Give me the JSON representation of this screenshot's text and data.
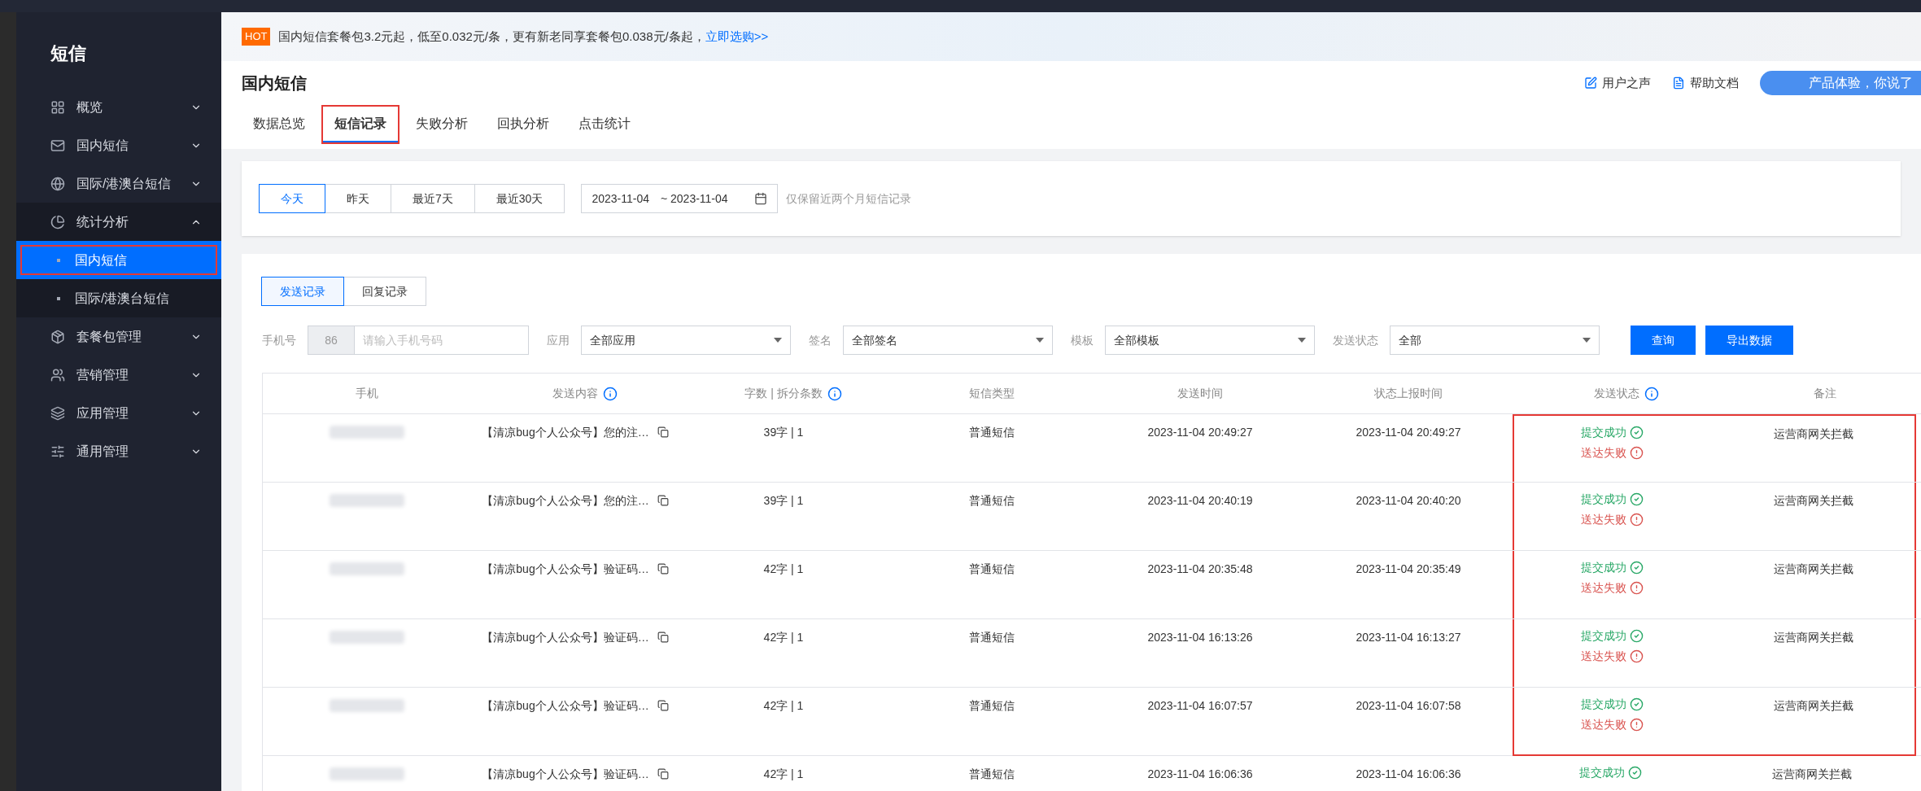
{
  "sidebar": {
    "title": "短信",
    "items": [
      {
        "label": "概览",
        "expanded": false,
        "selected": false
      },
      {
        "label": "国内短信",
        "expanded": false,
        "selected": false
      },
      {
        "label": "国际/港澳台短信",
        "expanded": false,
        "selected": false
      },
      {
        "label": "统计分析",
        "expanded": true,
        "selected": false,
        "children": [
          {
            "label": "国内短信",
            "selected": true,
            "highlighted": true
          },
          {
            "label": "国际/港澳台短信",
            "selected": false,
            "highlighted": false
          }
        ]
      },
      {
        "label": "套餐包管理",
        "expanded": false,
        "selected": false
      },
      {
        "label": "营销管理",
        "expanded": false,
        "selected": false
      },
      {
        "label": "应用管理",
        "expanded": false,
        "selected": false
      },
      {
        "label": "通用管理",
        "expanded": false,
        "selected": false
      }
    ]
  },
  "banner": {
    "badge": "HOT",
    "text": "国内短信套餐包3.2元起，低至0.032元/条，更有新老同享套餐包0.038元/条起，",
    "link": "立即选购>>"
  },
  "header": {
    "title": "国内短信",
    "links": [
      "用户之声",
      "帮助文档"
    ],
    "promo": "产品体验，你说了",
    "tabs": [
      {
        "label": "数据总览",
        "selected": false,
        "highlighted": false
      },
      {
        "label": "短信记录",
        "selected": true,
        "highlighted": true
      },
      {
        "label": "失败分析",
        "selected": false,
        "highlighted": false
      },
      {
        "label": "回执分析",
        "selected": false,
        "highlighted": false
      },
      {
        "label": "点击统计",
        "selected": false,
        "highlighted": false
      }
    ]
  },
  "date_filter": {
    "ranges": [
      {
        "label": "今天",
        "selected": true
      },
      {
        "label": "昨天",
        "selected": false
      },
      {
        "label": "最近7天",
        "selected": false
      },
      {
        "label": "最近30天",
        "selected": false
      }
    ],
    "start": "2023-11-04",
    "end": "~ 2023-11-04",
    "hint": "仅保留近两个月短信记录"
  },
  "record_tabs": [
    {
      "label": "发送记录",
      "selected": true
    },
    {
      "label": "回复记录",
      "selected": false
    }
  ],
  "filters": {
    "phone_label": "手机号",
    "country_code": "86",
    "phone_placeholder": "请输入手机号码",
    "selects": [
      {
        "label": "应用",
        "value": "全部应用"
      },
      {
        "label": "签名",
        "value": "全部签名"
      },
      {
        "label": "模板",
        "value": "全部模板"
      },
      {
        "label": "发送状态",
        "value": "全部"
      }
    ],
    "buttons": [
      "查询",
      "导出数据"
    ]
  },
  "table": {
    "columns": [
      {
        "label": "手机",
        "info": false
      },
      {
        "label": "发送内容",
        "info": true
      },
      {
        "label": "字数 | 拆分条数",
        "info": true
      },
      {
        "label": "短信类型",
        "info": false
      },
      {
        "label": "发送时间",
        "info": false
      },
      {
        "label": "状态上报时间",
        "info": false
      },
      {
        "label": "发送状态",
        "info": true
      },
      {
        "label": "备注",
        "info": false
      }
    ],
    "rows": [
      {
        "content": "【清凉bug个人公众号】您的注…",
        "count": "39字 | 1",
        "type": "普通短信",
        "sent": "2023-11-04 20:49:27",
        "reported": "2023-11-04 20:49:27",
        "statuses": [
          {
            "kind": "success",
            "label": "提交成功"
          },
          {
            "kind": "fail",
            "label": "送达失败"
          }
        ],
        "remark": "运营商网关拦截",
        "highlighted": true
      },
      {
        "content": "【清凉bug个人公众号】您的注…",
        "count": "39字 | 1",
        "type": "普通短信",
        "sent": "2023-11-04 20:40:19",
        "reported": "2023-11-04 20:40:20",
        "statuses": [
          {
            "kind": "success",
            "label": "提交成功"
          },
          {
            "kind": "fail",
            "label": "送达失败"
          }
        ],
        "remark": "运营商网关拦截",
        "highlighted": true
      },
      {
        "content": "【清凉bug个人公众号】验证码…",
        "count": "42字 | 1",
        "type": "普通短信",
        "sent": "2023-11-04 20:35:48",
        "reported": "2023-11-04 20:35:49",
        "statuses": [
          {
            "kind": "success",
            "label": "提交成功"
          },
          {
            "kind": "fail",
            "label": "送达失败"
          }
        ],
        "remark": "运营商网关拦截",
        "highlighted": true
      },
      {
        "content": "【清凉bug个人公众号】验证码…",
        "count": "42字 | 1",
        "type": "普通短信",
        "sent": "2023-11-04 16:13:26",
        "reported": "2023-11-04 16:13:27",
        "statuses": [
          {
            "kind": "success",
            "label": "提交成功"
          },
          {
            "kind": "fail",
            "label": "送达失败"
          }
        ],
        "remark": "运营商网关拦截",
        "highlighted": true
      },
      {
        "content": "【清凉bug个人公众号】验证码…",
        "count": "42字 | 1",
        "type": "普通短信",
        "sent": "2023-11-04 16:07:57",
        "reported": "2023-11-04 16:07:58",
        "statuses": [
          {
            "kind": "success",
            "label": "提交成功"
          },
          {
            "kind": "fail",
            "label": "送达失败"
          }
        ],
        "remark": "运营商网关拦截",
        "highlighted": true
      },
      {
        "content": "【清凉bug个人公众号】验证码…",
        "count": "42字 | 1",
        "type": "普通短信",
        "sent": "2023-11-04 16:06:36",
        "reported": "2023-11-04 16:06:36",
        "statuses": [
          {
            "kind": "success",
            "label": "提交成功"
          }
        ],
        "remark": "运营商网关拦截",
        "highlighted": false
      }
    ]
  }
}
